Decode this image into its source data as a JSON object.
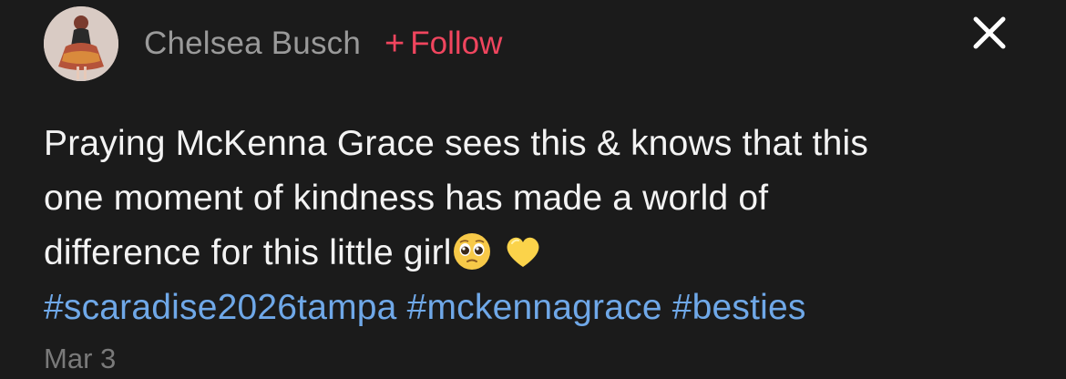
{
  "post": {
    "author": "Chelsea Busch",
    "follow_label": "Follow",
    "caption_lines": [
      "Praying McKenna Grace sees this & knows that this",
      "one moment of kindness has made a world of",
      "difference for this little girl"
    ],
    "emojis": [
      "pleading-face-icon",
      "yellow-heart-icon"
    ],
    "hashtags": [
      "#scaradise2026tampa",
      "#mckennagrace",
      "#besties"
    ],
    "date": "Mar 3"
  },
  "colors": {
    "background": "#1b1b1b",
    "follow_accent": "#f0455e",
    "hashtag": "#6fa8e8",
    "muted_text": "#9a9a9a"
  },
  "icons": {
    "close": "close-icon",
    "follow_plus": "plus-icon"
  }
}
